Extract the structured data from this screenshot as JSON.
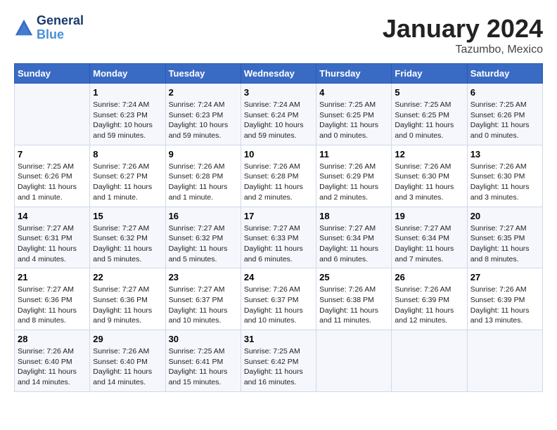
{
  "header": {
    "logo_line1": "General",
    "logo_line2": "Blue",
    "month_title": "January 2024",
    "location": "Tazumbo, Mexico"
  },
  "weekdays": [
    "Sunday",
    "Monday",
    "Tuesday",
    "Wednesday",
    "Thursday",
    "Friday",
    "Saturday"
  ],
  "weeks": [
    [
      {
        "day": "",
        "sunrise": "",
        "sunset": "",
        "daylight": ""
      },
      {
        "day": "1",
        "sunrise": "Sunrise: 7:24 AM",
        "sunset": "Sunset: 6:23 PM",
        "daylight": "Daylight: 10 hours and 59 minutes."
      },
      {
        "day": "2",
        "sunrise": "Sunrise: 7:24 AM",
        "sunset": "Sunset: 6:23 PM",
        "daylight": "Daylight: 10 hours and 59 minutes."
      },
      {
        "day": "3",
        "sunrise": "Sunrise: 7:24 AM",
        "sunset": "Sunset: 6:24 PM",
        "daylight": "Daylight: 10 hours and 59 minutes."
      },
      {
        "day": "4",
        "sunrise": "Sunrise: 7:25 AM",
        "sunset": "Sunset: 6:25 PM",
        "daylight": "Daylight: 11 hours and 0 minutes."
      },
      {
        "day": "5",
        "sunrise": "Sunrise: 7:25 AM",
        "sunset": "Sunset: 6:25 PM",
        "daylight": "Daylight: 11 hours and 0 minutes."
      },
      {
        "day": "6",
        "sunrise": "Sunrise: 7:25 AM",
        "sunset": "Sunset: 6:26 PM",
        "daylight": "Daylight: 11 hours and 0 minutes."
      }
    ],
    [
      {
        "day": "7",
        "sunrise": "Sunrise: 7:25 AM",
        "sunset": "Sunset: 6:26 PM",
        "daylight": "Daylight: 11 hours and 1 minute."
      },
      {
        "day": "8",
        "sunrise": "Sunrise: 7:26 AM",
        "sunset": "Sunset: 6:27 PM",
        "daylight": "Daylight: 11 hours and 1 minute."
      },
      {
        "day": "9",
        "sunrise": "Sunrise: 7:26 AM",
        "sunset": "Sunset: 6:28 PM",
        "daylight": "Daylight: 11 hours and 1 minute."
      },
      {
        "day": "10",
        "sunrise": "Sunrise: 7:26 AM",
        "sunset": "Sunset: 6:28 PM",
        "daylight": "Daylight: 11 hours and 2 minutes."
      },
      {
        "day": "11",
        "sunrise": "Sunrise: 7:26 AM",
        "sunset": "Sunset: 6:29 PM",
        "daylight": "Daylight: 11 hours and 2 minutes."
      },
      {
        "day": "12",
        "sunrise": "Sunrise: 7:26 AM",
        "sunset": "Sunset: 6:30 PM",
        "daylight": "Daylight: 11 hours and 3 minutes."
      },
      {
        "day": "13",
        "sunrise": "Sunrise: 7:26 AM",
        "sunset": "Sunset: 6:30 PM",
        "daylight": "Daylight: 11 hours and 3 minutes."
      }
    ],
    [
      {
        "day": "14",
        "sunrise": "Sunrise: 7:27 AM",
        "sunset": "Sunset: 6:31 PM",
        "daylight": "Daylight: 11 hours and 4 minutes."
      },
      {
        "day": "15",
        "sunrise": "Sunrise: 7:27 AM",
        "sunset": "Sunset: 6:32 PM",
        "daylight": "Daylight: 11 hours and 5 minutes."
      },
      {
        "day": "16",
        "sunrise": "Sunrise: 7:27 AM",
        "sunset": "Sunset: 6:32 PM",
        "daylight": "Daylight: 11 hours and 5 minutes."
      },
      {
        "day": "17",
        "sunrise": "Sunrise: 7:27 AM",
        "sunset": "Sunset: 6:33 PM",
        "daylight": "Daylight: 11 hours and 6 minutes."
      },
      {
        "day": "18",
        "sunrise": "Sunrise: 7:27 AM",
        "sunset": "Sunset: 6:34 PM",
        "daylight": "Daylight: 11 hours and 6 minutes."
      },
      {
        "day": "19",
        "sunrise": "Sunrise: 7:27 AM",
        "sunset": "Sunset: 6:34 PM",
        "daylight": "Daylight: 11 hours and 7 minutes."
      },
      {
        "day": "20",
        "sunrise": "Sunrise: 7:27 AM",
        "sunset": "Sunset: 6:35 PM",
        "daylight": "Daylight: 11 hours and 8 minutes."
      }
    ],
    [
      {
        "day": "21",
        "sunrise": "Sunrise: 7:27 AM",
        "sunset": "Sunset: 6:36 PM",
        "daylight": "Daylight: 11 hours and 8 minutes."
      },
      {
        "day": "22",
        "sunrise": "Sunrise: 7:27 AM",
        "sunset": "Sunset: 6:36 PM",
        "daylight": "Daylight: 11 hours and 9 minutes."
      },
      {
        "day": "23",
        "sunrise": "Sunrise: 7:27 AM",
        "sunset": "Sunset: 6:37 PM",
        "daylight": "Daylight: 11 hours and 10 minutes."
      },
      {
        "day": "24",
        "sunrise": "Sunrise: 7:26 AM",
        "sunset": "Sunset: 6:37 PM",
        "daylight": "Daylight: 11 hours and 10 minutes."
      },
      {
        "day": "25",
        "sunrise": "Sunrise: 7:26 AM",
        "sunset": "Sunset: 6:38 PM",
        "daylight": "Daylight: 11 hours and 11 minutes."
      },
      {
        "day": "26",
        "sunrise": "Sunrise: 7:26 AM",
        "sunset": "Sunset: 6:39 PM",
        "daylight": "Daylight: 11 hours and 12 minutes."
      },
      {
        "day": "27",
        "sunrise": "Sunrise: 7:26 AM",
        "sunset": "Sunset: 6:39 PM",
        "daylight": "Daylight: 11 hours and 13 minutes."
      }
    ],
    [
      {
        "day": "28",
        "sunrise": "Sunrise: 7:26 AM",
        "sunset": "Sunset: 6:40 PM",
        "daylight": "Daylight: 11 hours and 14 minutes."
      },
      {
        "day": "29",
        "sunrise": "Sunrise: 7:26 AM",
        "sunset": "Sunset: 6:40 PM",
        "daylight": "Daylight: 11 hours and 14 minutes."
      },
      {
        "day": "30",
        "sunrise": "Sunrise: 7:25 AM",
        "sunset": "Sunset: 6:41 PM",
        "daylight": "Daylight: 11 hours and 15 minutes."
      },
      {
        "day": "31",
        "sunrise": "Sunrise: 7:25 AM",
        "sunset": "Sunset: 6:42 PM",
        "daylight": "Daylight: 11 hours and 16 minutes."
      },
      {
        "day": "",
        "sunrise": "",
        "sunset": "",
        "daylight": ""
      },
      {
        "day": "",
        "sunrise": "",
        "sunset": "",
        "daylight": ""
      },
      {
        "day": "",
        "sunrise": "",
        "sunset": "",
        "daylight": ""
      }
    ]
  ]
}
